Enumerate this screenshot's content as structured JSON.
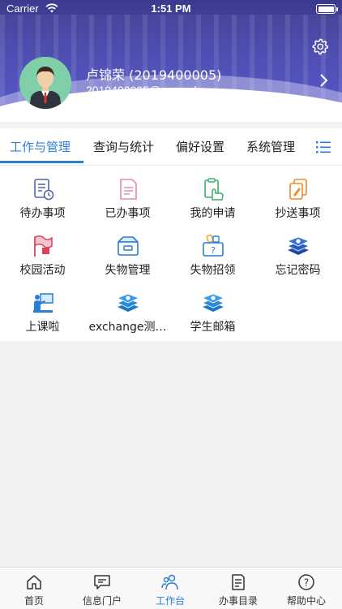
{
  "status_bar": {
    "carrier": "Carrier",
    "time": "1:51 PM"
  },
  "profile": {
    "name": "卢锦荣 (2019400005)",
    "email": "2019400005@zwu.edu.cn"
  },
  "tabs": [
    {
      "label": "工作与管理",
      "active": true
    },
    {
      "label": "查询与统计",
      "active": false
    },
    {
      "label": "偏好设置",
      "active": false
    },
    {
      "label": "系统管理",
      "active": false
    }
  ],
  "apps": [
    {
      "label": "待办事项",
      "icon": "todo-doc-clock-icon"
    },
    {
      "label": "已办事项",
      "icon": "done-doc-icon"
    },
    {
      "label": "我的申请",
      "icon": "my-application-hand-icon"
    },
    {
      "label": "抄送事项",
      "icon": "cc-docs-icon"
    },
    {
      "label": "校园活动",
      "icon": "campus-activity-flag-icon"
    },
    {
      "label": "失物管理",
      "icon": "lost-found-box-icon"
    },
    {
      "label": "失物招领",
      "icon": "lost-claim-question-box-icon"
    },
    {
      "label": "忘记密码",
      "icon": "stack-layers-icon"
    },
    {
      "label": "上课啦",
      "icon": "classroom-teacher-icon"
    },
    {
      "label": "exchange测…",
      "icon": "stack-layers-icon"
    },
    {
      "label": "学生邮箱",
      "icon": "stack-layers-icon"
    }
  ],
  "bottom_nav": [
    {
      "label": "首页",
      "icon": "home-icon",
      "active": false
    },
    {
      "label": "信息门户",
      "icon": "message-portal-icon",
      "active": false
    },
    {
      "label": "工作台",
      "icon": "workbench-people-icon",
      "active": true
    },
    {
      "label": "办事目录",
      "icon": "service-catalog-icon",
      "active": false
    },
    {
      "label": "帮助中心",
      "icon": "help-circle-icon",
      "active": false
    }
  ],
  "colors": {
    "accent": "#2a7fd4",
    "header": "#4b4bb0"
  }
}
